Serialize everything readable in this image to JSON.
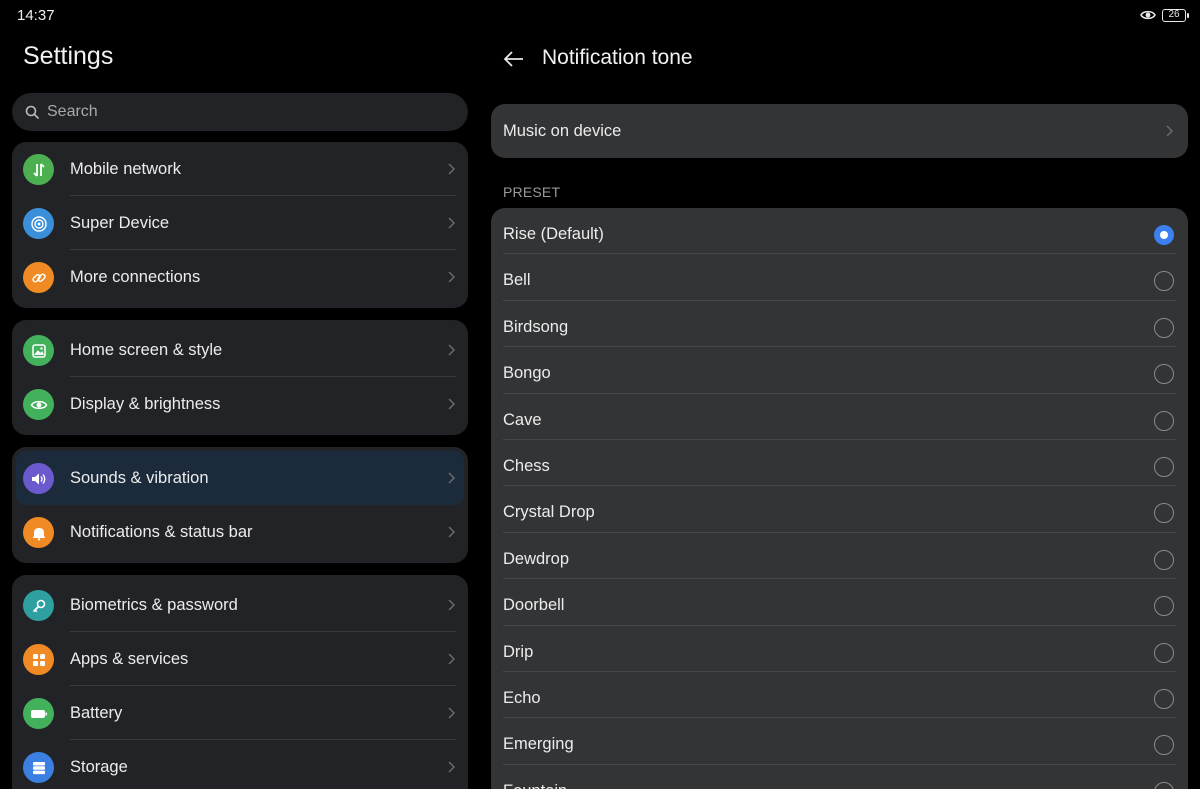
{
  "status_bar": {
    "time": "14:37",
    "battery": "26"
  },
  "left": {
    "title": "Settings",
    "search": {
      "placeholder": "Search",
      "value": ""
    },
    "groups": [
      {
        "items": [
          {
            "label": "Mobile network",
            "icon": "mobile-network-icon",
            "color": "#4caf50"
          },
          {
            "label": "Super Device",
            "icon": "super-device-icon",
            "color": "#3b8fd9"
          },
          {
            "label": "More connections",
            "icon": "link-icon",
            "color": "#f08a24"
          }
        ]
      },
      {
        "items": [
          {
            "label": "Home screen & style",
            "icon": "image-icon",
            "color": "#43b05c"
          },
          {
            "label": "Display & brightness",
            "icon": "eye-icon",
            "color": "#43b05c"
          }
        ]
      },
      {
        "items": [
          {
            "label": "Sounds & vibration",
            "icon": "speaker-icon",
            "color": "#6a5acd",
            "selected": true
          },
          {
            "label": "Notifications & status bar",
            "icon": "bell-icon",
            "color": "#f08a24"
          }
        ]
      },
      {
        "items": [
          {
            "label": "Biometrics & password",
            "icon": "key-icon",
            "color": "#2fa0a0"
          },
          {
            "label": "Apps & services",
            "icon": "apps-grid-icon",
            "color": "#f08a24"
          },
          {
            "label": "Battery",
            "icon": "battery-icon",
            "color": "#43b05c"
          },
          {
            "label": "Storage",
            "icon": "storage-icon",
            "color": "#3b7fe0"
          }
        ]
      }
    ]
  },
  "right": {
    "title": "Notification tone",
    "music_on_device": "Music on device",
    "section_header": "PRESET",
    "tones": [
      {
        "label": "Rise (Default)",
        "checked": true
      },
      {
        "label": "Bell",
        "checked": false
      },
      {
        "label": "Birdsong",
        "checked": false
      },
      {
        "label": "Bongo",
        "checked": false
      },
      {
        "label": "Cave",
        "checked": false
      },
      {
        "label": "Chess",
        "checked": false
      },
      {
        "label": "Crystal Drop",
        "checked": false
      },
      {
        "label": "Dewdrop",
        "checked": false
      },
      {
        "label": "Doorbell",
        "checked": false
      },
      {
        "label": "Drip",
        "checked": false
      },
      {
        "label": "Echo",
        "checked": false
      },
      {
        "label": "Emerging",
        "checked": false
      },
      {
        "label": "Fountain",
        "checked": false
      }
    ]
  }
}
